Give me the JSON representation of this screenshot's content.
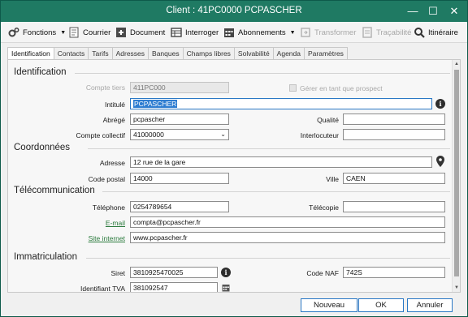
{
  "window": {
    "title": "Client : 41PC0000 PCPASCHER",
    "controls": {
      "minimize": "—",
      "maximize": "☐",
      "close": "✕"
    }
  },
  "toolbar": {
    "fonctions": "Fonctions",
    "courrier": "Courrier",
    "document": "Document",
    "interroger": "Interroger",
    "abonnements": "Abonnements",
    "transformer": "Transformer",
    "tracabilite": "Traçabilité",
    "itineraire": "Itinéraire"
  },
  "tabs": [
    "Identification",
    "Contacts",
    "Tarifs",
    "Adresses",
    "Banques",
    "Champs libres",
    "Solvabilité",
    "Agenda",
    "Paramètres"
  ],
  "identification": {
    "section": "Identification",
    "compte_tiers_label": "Compte tiers",
    "compte_tiers_value": "411PC000",
    "prospect_label": "Gérer en tant que prospect",
    "intitule_label": "Intitulé",
    "intitule_value": "PCPASCHER",
    "abrege_label": "Abrégé",
    "abrege_value": "pcpascher",
    "qualite_label": "Qualité",
    "qualite_value": "",
    "compte_collectif_label": "Compte collectif",
    "compte_collectif_value": "41000000",
    "interlocuteur_label": "Interlocuteur",
    "interlocuteur_value": ""
  },
  "coordonnees": {
    "section": "Coordonnées",
    "adresse_label": "Adresse",
    "adresse_value": "12 rue de la gare",
    "code_postal_label": "Code postal",
    "code_postal_value": "14000",
    "ville_label": "Ville",
    "ville_value": "CAEN"
  },
  "telecom": {
    "section": "Télécommunication",
    "telephone_label": "Téléphone",
    "telephone_value": "0254789654",
    "telecopie_label": "Télécopie",
    "telecopie_value": "",
    "email_label": "E-mail",
    "email_value": "compta@pcpascher.fr",
    "site_label": "Site internet",
    "site_value": "www.pcpascher.fr"
  },
  "immatriculation": {
    "section": "Immatriculation",
    "siret_label": "Siret",
    "siret_value": "3810925470025",
    "code_naf_label": "Code NAF",
    "code_naf_value": "742S",
    "tva_label": "Identifiant TVA",
    "tva_value": "381092547"
  },
  "buttons": {
    "nouveau": "Nouveau",
    "ok": "OK",
    "annuler": "Annuler"
  },
  "colors": {
    "titlebar": "#1f7a63",
    "accent": "#2b78c5",
    "link": "#2a7a3c",
    "selection": "#2e7dd1"
  }
}
